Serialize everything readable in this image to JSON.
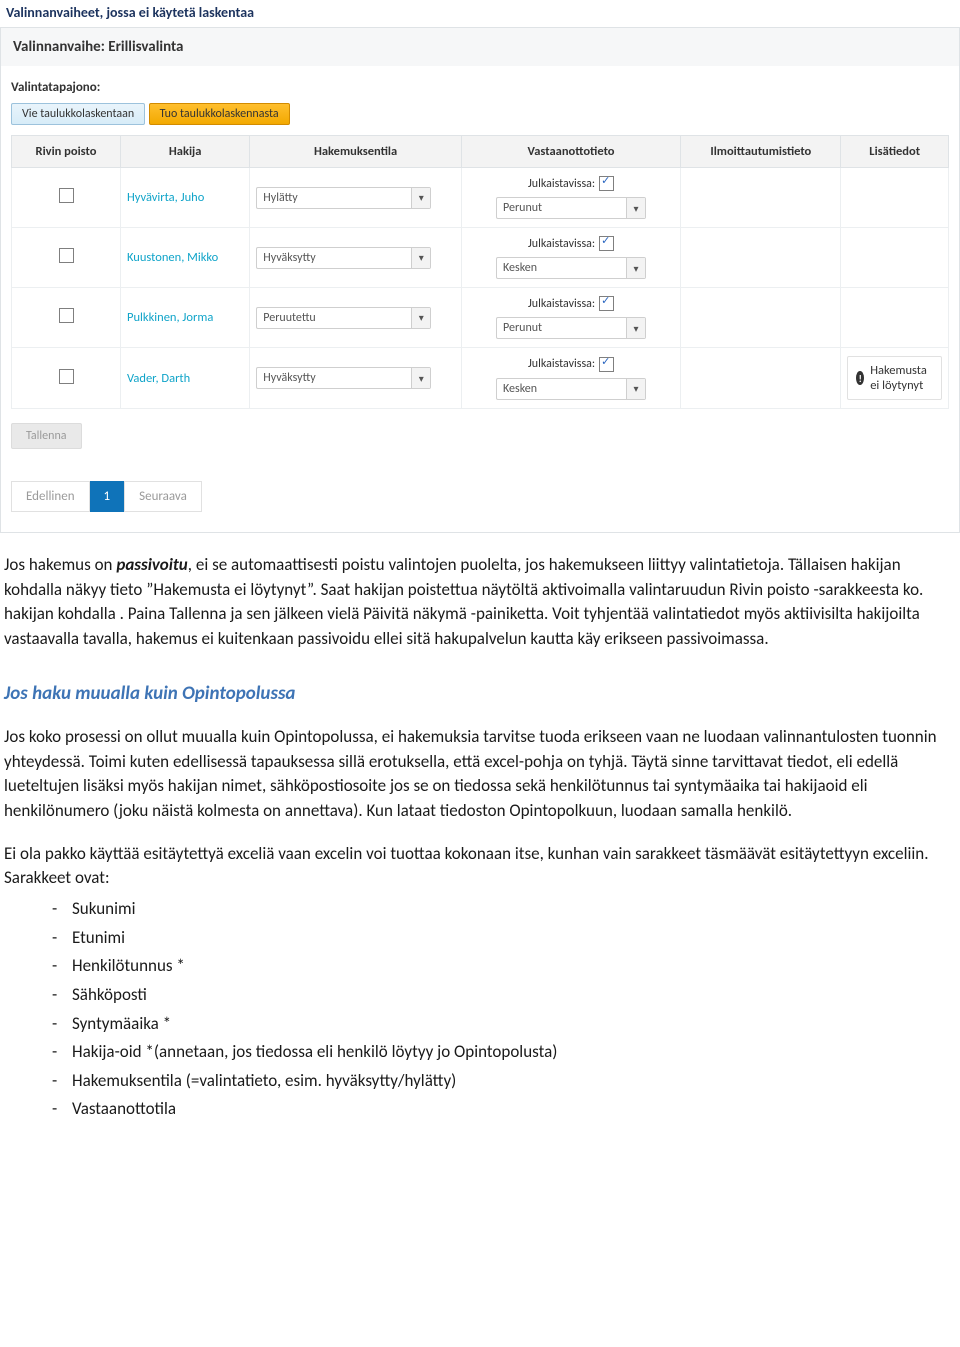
{
  "panel": {
    "section_title": "Valinnanvaiheet, jossa ei käytetä laskentaa",
    "phase_title": "Valinnanvaihe: Erillisvalinta",
    "queue_label": "Valintatapajono:",
    "btn_export": "Vie taulukkolaskentaan",
    "btn_import": "Tuo taulukkolaskennasta",
    "columns": {
      "c1": "Rivin poisto",
      "c2": "Hakija",
      "c3": "Hakemuksentila",
      "c4": "Vastaanottotieto",
      "c5": "Ilmoittautumistieto",
      "c6": "Lisätiedot"
    },
    "publish_label": "Julkaistavissa:",
    "rows": [
      {
        "name": "Hyvävirta, Juho",
        "status": "Hylätty",
        "receive": "Perunut",
        "info": ""
      },
      {
        "name": "Kuustonen, Mikko",
        "status": "Hyväksytty",
        "receive": "Kesken",
        "info": ""
      },
      {
        "name": "Pulkkinen, Jorma",
        "status": "Peruutettu",
        "receive": "Perunut",
        "info": ""
      },
      {
        "name": "Vader, Darth",
        "status": "Hyväksytty",
        "receive": "Kesken",
        "info": "Hakemusta ei löytynyt"
      }
    ],
    "save_label": "Tallenna",
    "pager_prev": "Edellinen",
    "pager_page": "1",
    "pager_next": "Seuraava"
  },
  "doc": {
    "p1a": "Jos hakemus on ",
    "p1em": "passivoitu",
    "p1b": ", ei se automaattisesti poistu valintojen puolelta, jos hakemukseen liittyy valintatietoja. Tällaisen hakijan kohdalla näkyy tieto ”Hakemusta ei löytynyt”. Saat hakijan poistettua näytöltä aktivoimalla valintaruudun Rivin poisto -sarakkeesta ko. hakijan kohdalla . Paina Tallenna ja sen jälkeen vielä Päivitä näkymä -painiketta. Voit tyhjentää valintatiedot myös aktiivisilta hakijoilta vastaavalla tavalla, hakemus ei kuitenkaan passivoidu ellei sitä hakupalvelun kautta käy erikseen passivoimassa.",
    "h3": "Jos haku muualla kuin Opintopolussa",
    "p2": "Jos koko prosessi on ollut muualla kuin Opintopolussa, ei hakemuksia tarvitse tuoda erikseen vaan ne luodaan valinnantulosten tuonnin yhteydessä. Toimi kuten edellisessä tapauksessa sillä erotuksella, että excel-pohja on tyhjä. Täytä sinne tarvittavat tiedot, eli edellä lueteltujen lisäksi myös hakijan nimet, sähköpostiosoite jos se on tiedossa sekä henkilötunnus tai syntymäaika tai hakijaoid eli henkilönumero (joku näistä kolmesta on annettava). Kun lataat tiedoston Opintopolkuun, luodaan samalla henkilö.",
    "p3": "Ei ola pakko käyttää esitäytettyä exceliä vaan excelin voi tuottaa kokonaan itse, kunhan vain sarakkeet täsmäävät esitäytettyyn exceliin. Sarakkeet ovat:",
    "list": [
      "Sukunimi",
      "Etunimi",
      "Henkilötunnus *",
      "Sähköposti",
      "Syntymäaika *",
      "Hakija-oid *(annetaan, jos tiedossa eli henkilö löytyy jo Opintopolusta)",
      "Hakemuksentila (=valintatieto, esim. hyväksytty/hylätty)",
      "Vastaanottotila"
    ]
  }
}
